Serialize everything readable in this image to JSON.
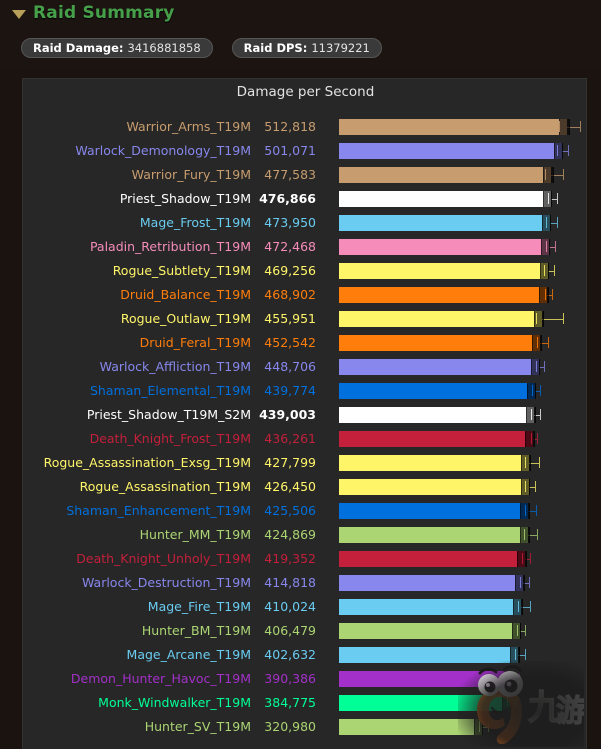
{
  "header": {
    "collapse_icon": "triangle-down-icon",
    "title": "Raid Summary",
    "badges": [
      {
        "label": "Raid Damage:",
        "value": "3416881858"
      },
      {
        "label": "Raid DPS:",
        "value": "11379221"
      }
    ]
  },
  "colors": {
    "section_title": "#46a04a",
    "panel_bg": "#272727",
    "page_bg": "#1a1310",
    "badge_bg": "#3a3a3a"
  },
  "watermark": {
    "name": "jiuyou-logo-watermark",
    "text": "九游"
  },
  "chart_data": {
    "type": "bar",
    "title": "Damage per Second",
    "xlabel": "",
    "ylabel": "",
    "grid": false,
    "legend": false,
    "orientation": "horizontal",
    "xlim": [
      0,
      560000
    ],
    "value_format": "comma-separated integers",
    "categories": [
      "Warrior_Arms_T19M",
      "Warlock_Demonology_T19M",
      "Warrior_Fury_T19M",
      "Priest_Shadow_T19M",
      "Mage_Frost_T19M",
      "Paladin_Retribution_T19M",
      "Rogue_Subtlety_T19M",
      "Druid_Balance_T19M",
      "Rogue_Outlaw_T19M",
      "Druid_Feral_T19M",
      "Warlock_Affliction_T19M",
      "Shaman_Elemental_T19M",
      "Priest_Shadow_T19M_S2M",
      "Death_Knight_Frost_T19M",
      "Rogue_Assassination_Exsg_T19M",
      "Rogue_Assassination_T19M",
      "Shaman_Enhancement_T19M",
      "Hunter_MM_T19M",
      "Death_Knight_Unholy_T19M",
      "Warlock_Destruction_T19M",
      "Mage_Fire_T19M",
      "Hunter_BM_T19M",
      "Mage_Arcane_T19M",
      "Demon_Hunter_Havoc_T19M",
      "Monk_Windwalker_T19M",
      "Hunter_SV_T19M"
    ],
    "values": [
      512818,
      501071,
      477583,
      476866,
      473950,
      472468,
      469256,
      468902,
      455951,
      452542,
      448706,
      439774,
      439003,
      436261,
      427799,
      426450,
      425506,
      424869,
      419352,
      414818,
      410024,
      406479,
      402632,
      390386,
      384775,
      320980
    ],
    "value_labels": [
      "512,818",
      "501,071",
      "477,583",
      "476,866",
      "473,950",
      "472,468",
      "469,256",
      "468,902",
      "455,951",
      "452,542",
      "448,706",
      "439,774",
      "439,003",
      "436,261",
      "427,799",
      "426,450",
      "425,506",
      "424,869",
      "419,352",
      "414,818",
      "410,024",
      "406,479",
      "402,632",
      "390,386",
      "384,775",
      "320,980"
    ],
    "bar_colors": [
      "#c79c6e",
      "#8787ed",
      "#c79c6e",
      "#ffffff",
      "#69ccf0",
      "#f58cba",
      "#fff569",
      "#ff7d0a",
      "#fff569",
      "#ff7d0a",
      "#8787ed",
      "#0070de",
      "#ffffff",
      "#c41f3b",
      "#fff569",
      "#fff569",
      "#0070de",
      "#abd473",
      "#c41f3b",
      "#8787ed",
      "#69ccf0",
      "#abd473",
      "#69ccf0",
      "#a330c9",
      "#00ff96",
      "#abd473"
    ],
    "label_colors": [
      "#c79c6e",
      "#8787ed",
      "#c79c6e",
      "#ffffff",
      "#69ccf0",
      "#f58cba",
      "#fff569",
      "#ff7d0a",
      "#fff569",
      "#ff7d0a",
      "#8787ed",
      "#0070de",
      "#ffffff",
      "#c41f3b",
      "#fff569",
      "#fff569",
      "#0070de",
      "#abd473",
      "#c41f3b",
      "#8787ed",
      "#69ccf0",
      "#abd473",
      "#69ccf0",
      "#a330c9",
      "#00ff96",
      "#abd473"
    ],
    "boxplot": [
      {
        "median": 495000,
        "q1": 475000,
        "q3": 519000,
        "whisker_low": 475000,
        "whisker_high": 542000
      },
      {
        "median": 490000,
        "q1": 482000,
        "q3": 504000,
        "whisker_low": 482000,
        "whisker_high": 515000
      },
      {
        "median": 464000,
        "q1": 452000,
        "q3": 483000,
        "whisker_low": 452000,
        "whisker_high": 504000
      },
      {
        "median": 470000,
        "q1": 464000,
        "q3": 480000,
        "whisker_low": 464000,
        "whisker_high": 490000
      },
      {
        "median": 466000,
        "q1": 458000,
        "q3": 477000,
        "whisker_low": 458000,
        "whisker_high": 491000
      },
      {
        "median": 465000,
        "q1": 458000,
        "q3": 475000,
        "whisker_low": 458000,
        "whisker_high": 486000
      },
      {
        "median": 461000,
        "q1": 453000,
        "q3": 472000,
        "whisker_low": 453000,
        "whisker_high": 484000
      },
      {
        "median": 463000,
        "q1": 456000,
        "q3": 472000,
        "whisker_low": 456000,
        "whisker_high": 480000
      },
      {
        "median": 443000,
        "q1": 434000,
        "q3": 460000,
        "whisker_low": 434000,
        "whisker_high": 503000
      },
      {
        "median": 446000,
        "q1": 439000,
        "q3": 456000,
        "whisker_low": 439000,
        "whisker_high": 469000
      },
      {
        "median": 442000,
        "q1": 436000,
        "q3": 452000,
        "whisker_low": 436000,
        "whisker_high": 462000
      },
      {
        "median": 434000,
        "q1": 428000,
        "q3": 443000,
        "whisker_low": 428000,
        "whisker_high": 452000
      },
      {
        "median": 432000,
        "q1": 425000,
        "q3": 443000,
        "whisker_low": 425000,
        "whisker_high": 453000
      },
      {
        "median": 431000,
        "q1": 425000,
        "q3": 440000,
        "whisker_low": 425000,
        "whisker_high": 446000
      },
      {
        "median": 418000,
        "q1": 409000,
        "q3": 431000,
        "whisker_low": 409000,
        "whisker_high": 450000
      },
      {
        "median": 419000,
        "q1": 413000,
        "q3": 430000,
        "whisker_low": 413000,
        "whisker_high": 440000
      },
      {
        "median": 418000,
        "q1": 409000,
        "q3": 429000,
        "whisker_low": 409000,
        "whisker_high": 442000
      },
      {
        "median": 416000,
        "q1": 407000,
        "q3": 429000,
        "whisker_low": 407000,
        "whisker_high": 446000
      },
      {
        "median": 412000,
        "q1": 406000,
        "q3": 423000,
        "whisker_low": 406000,
        "whisker_high": 430000
      },
      {
        "median": 408000,
        "q1": 402000,
        "q3": 418000,
        "whisker_low": 402000,
        "whisker_high": 428000
      },
      {
        "median": 402000,
        "q1": 394000,
        "q3": 414000,
        "whisker_low": 394000,
        "whisker_high": 430000
      },
      {
        "median": 400000,
        "q1": 394000,
        "q3": 410000,
        "whisker_low": 394000,
        "whisker_high": 419000
      },
      {
        "median": 395000,
        "q1": 388000,
        "q3": 406000,
        "whisker_low": 388000,
        "whisker_high": 418000
      },
      {
        "median": 383000,
        "q1": 376000,
        "q3": 394000,
        "whisker_low": 376000,
        "whisker_high": 405000
      },
      {
        "median": 378000,
        "q1": 371000,
        "q3": 388000,
        "whisker_low": 371000,
        "whisker_high": 398000
      },
      {
        "median": 314000,
        "q1": 307000,
        "q3": 324000,
        "whisker_low": 307000,
        "whisker_high": 334000
      }
    ]
  }
}
